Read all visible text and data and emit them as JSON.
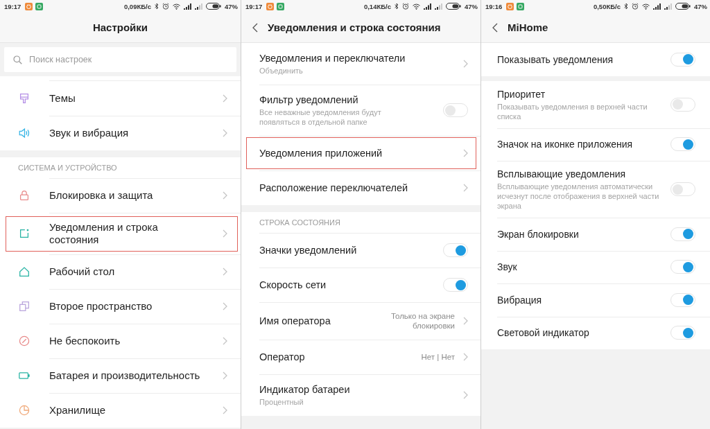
{
  "screens": [
    {
      "status_bar": {
        "time": "19:17",
        "network_speed": "0,09КБ/с",
        "battery": "47%"
      },
      "header": {
        "title": "Настройки",
        "back": false
      },
      "search": {
        "placeholder": "Поиск настроек"
      },
      "sections": [
        {
          "items": [
            {
              "kind": "icon_link",
              "label": "Темы",
              "highlighted": false
            },
            {
              "kind": "icon_link",
              "label": "Звук и вибрация",
              "highlighted": false
            }
          ]
        },
        {
          "heading": "СИСТЕМА И УСТРОЙСТВО",
          "items": [
            {
              "kind": "icon_link",
              "label": "Блокировка и защита",
              "highlighted": false
            },
            {
              "kind": "icon_link",
              "label": "Уведомления и строка состояния",
              "highlighted": true
            },
            {
              "kind": "icon_link",
              "label": "Рабочий стол",
              "highlighted": false
            },
            {
              "kind": "icon_link",
              "label": "Второе пространство",
              "highlighted": false
            },
            {
              "kind": "icon_link",
              "label": "Не беспокоить",
              "highlighted": false
            },
            {
              "kind": "icon_link",
              "label": "Батарея и производительность",
              "highlighted": false
            },
            {
              "kind": "icon_link",
              "label": "Хранилище",
              "highlighted": false
            }
          ]
        }
      ]
    },
    {
      "status_bar": {
        "time": "19:17",
        "network_speed": "0,14КБ/с",
        "battery": "47%"
      },
      "header": {
        "title": "Уведомления и строка состояния",
        "back": true
      },
      "sections": [
        {
          "items": [
            {
              "kind": "link",
              "label": "Уведомления и переключатели",
              "subtitle": "Объединить",
              "highlighted": false
            },
            {
              "kind": "toggle",
              "label": "Фильтр уведомлений",
              "subtitle": "Все неважные уведомления будут появляться в отдельной папке",
              "on": false,
              "highlighted": false
            },
            {
              "kind": "link",
              "label": "Уведомления приложений",
              "highlighted": true
            },
            {
              "kind": "link",
              "label": "Расположение переключателей",
              "highlighted": false
            }
          ]
        },
        {
          "heading": "СТРОКА СОСТОЯНИЯ",
          "items": [
            {
              "kind": "toggle",
              "label": "Значки уведомлений",
              "on": true,
              "highlighted": false
            },
            {
              "kind": "toggle",
              "label": "Скорость сети",
              "on": true,
              "highlighted": false
            },
            {
              "kind": "link",
              "label": "Имя оператора",
              "value": "Только на экране блокировки",
              "highlighted": false
            },
            {
              "kind": "link",
              "label": "Оператор",
              "value": "Нет | Нет",
              "highlighted": false
            },
            {
              "kind": "link",
              "label": "Индикатор батареи",
              "subtitle": "Процентный",
              "highlighted": false
            }
          ]
        }
      ]
    },
    {
      "status_bar": {
        "time": "19:16",
        "network_speed": "0,50КБ/с",
        "battery": "47%"
      },
      "header": {
        "title": "MiHome",
        "back": true
      },
      "sections": [
        {
          "items": [
            {
              "kind": "toggle",
              "label": "Показывать уведомления",
              "on": true,
              "highlighted": false
            }
          ]
        },
        {
          "items": [
            {
              "kind": "toggle",
              "label": "Приоритет",
              "subtitle": "Показывать уведомления в верхней части списка",
              "on": false,
              "highlighted": false
            },
            {
              "kind": "toggle",
              "label": "Значок на иконке приложения",
              "on": true,
              "highlighted": false
            },
            {
              "kind": "toggle",
              "label": "Всплывающие уведомления",
              "subtitle": "Всплывающие уведомления автоматически исчезнут после отображения в верхней части экрана",
              "on": false,
              "highlighted": false
            },
            {
              "kind": "toggle",
              "label": "Экран блокировки",
              "on": true,
              "highlighted": false
            },
            {
              "kind": "toggle",
              "label": "Звук",
              "on": true,
              "highlighted": false
            },
            {
              "kind": "toggle",
              "label": "Вибрация",
              "on": true,
              "highlighted": false
            },
            {
              "kind": "toggle",
              "label": "Световой индикатор",
              "on": true,
              "highlighted": false
            }
          ]
        }
      ]
    }
  ]
}
